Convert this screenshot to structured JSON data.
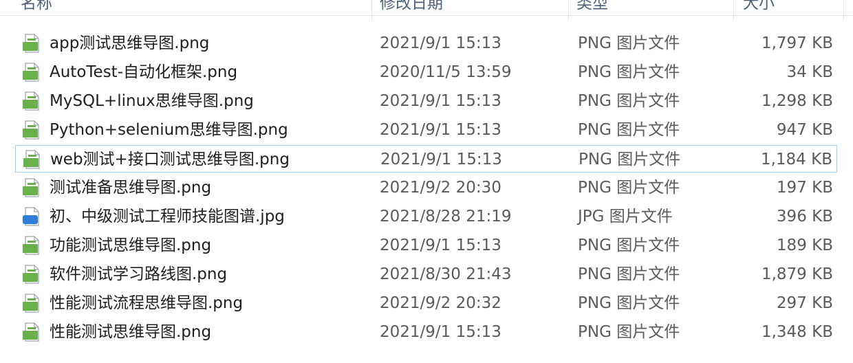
{
  "columns": {
    "name": "名称",
    "date": "修改日期",
    "type": "类型",
    "size": "大小"
  },
  "files": [
    {
      "name": "app测试思维导图.png",
      "date": "2021/9/1 15:13",
      "type": "PNG 图片文件",
      "size": "1,797 KB",
      "icon": "png-file-icon",
      "selected": false
    },
    {
      "name": "AutoTest-自动化框架.png",
      "date": "2020/11/5 13:59",
      "type": "PNG 图片文件",
      "size": "34 KB",
      "icon": "png-file-icon",
      "selected": false
    },
    {
      "name": "MySQL+linux思维导图.png",
      "date": "2021/9/1 15:13",
      "type": "PNG 图片文件",
      "size": "1,298 KB",
      "icon": "png-file-icon",
      "selected": false
    },
    {
      "name": "Python+selenium思维导图.png",
      "date": "2021/9/1 15:13",
      "type": "PNG 图片文件",
      "size": "947 KB",
      "icon": "png-file-icon",
      "selected": false
    },
    {
      "name": "web测试+接口测试思维导图.png",
      "date": "2021/9/1 15:13",
      "type": "PNG 图片文件",
      "size": "1,184 KB",
      "icon": "png-file-icon",
      "selected": true
    },
    {
      "name": "测试准备思维导图.png",
      "date": "2021/9/2 20:30",
      "type": "PNG 图片文件",
      "size": "197 KB",
      "icon": "png-file-icon",
      "selected": false
    },
    {
      "name": "初、中级测试工程师技能图谱.jpg",
      "date": "2021/8/28 21:19",
      "type": "JPG 图片文件",
      "size": "396 KB",
      "icon": "jpg-file-icon",
      "selected": false
    },
    {
      "name": "功能测试思维导图.png",
      "date": "2021/9/1 15:13",
      "type": "PNG 图片文件",
      "size": "189 KB",
      "icon": "png-file-icon",
      "selected": false
    },
    {
      "name": "软件测试学习路线图.png",
      "date": "2021/8/30 21:43",
      "type": "PNG 图片文件",
      "size": "1,879 KB",
      "icon": "png-file-icon",
      "selected": false
    },
    {
      "name": "性能测试流程思维导图.png",
      "date": "2021/9/2 20:32",
      "type": "PNG 图片文件",
      "size": "297 KB",
      "icon": "png-file-icon",
      "selected": false
    },
    {
      "name": "性能测试思维导图.png",
      "date": "2021/9/1 15:13",
      "type": "PNG 图片文件",
      "size": "1,348 KB",
      "icon": "png-file-icon",
      "selected": false
    }
  ],
  "colors": {
    "png_icon": "#6ab04c",
    "jpg_icon": "#2f7fd6",
    "selection_border": "#99d1ff"
  }
}
